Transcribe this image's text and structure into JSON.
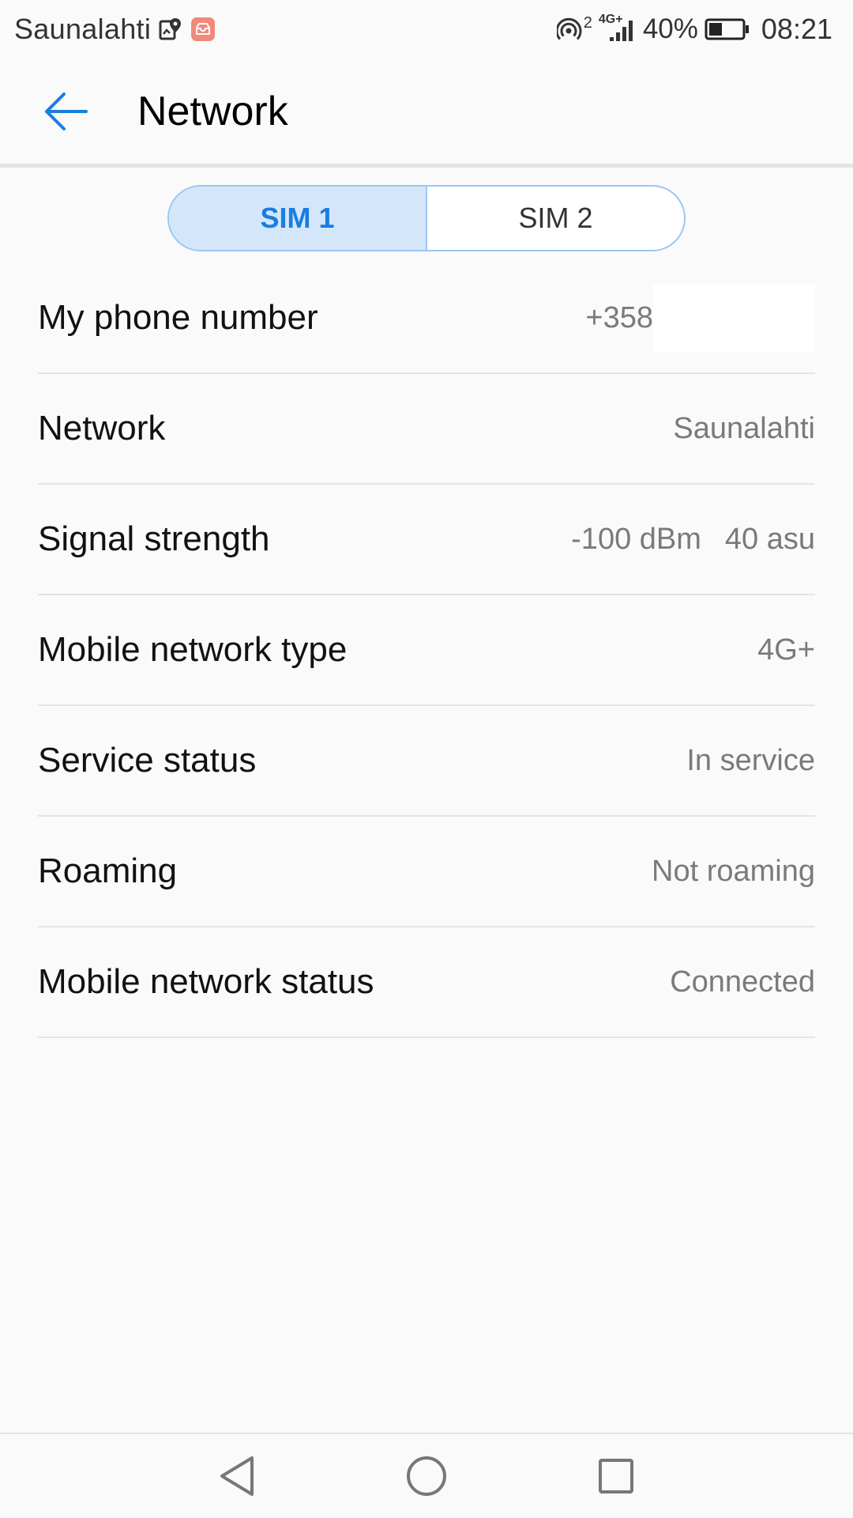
{
  "status_bar": {
    "carrier": "Saunalahti",
    "hotspot_superscript": "2",
    "network_type": "4G+",
    "battery_percent": "40%",
    "battery_level": 0.4,
    "time": "08:21",
    "icons": [
      "map-pin-icon",
      "mail-app-icon",
      "hotspot-icon",
      "signal-icon",
      "battery-icon"
    ]
  },
  "header": {
    "title": "Network"
  },
  "sim_tabs": {
    "selected": "SIM 1",
    "tabs": [
      {
        "label": "SIM 1"
      },
      {
        "label": "SIM 2"
      }
    ]
  },
  "info": {
    "phone_number": {
      "label": "My phone number",
      "value": "+358"
    },
    "network": {
      "label": "Network",
      "value": "Saunalahti"
    },
    "signal_strength": {
      "label": "Signal strength",
      "dbm": "-100 dBm",
      "asu": "40 asu"
    },
    "mobile_network_type": {
      "label": "Mobile network type",
      "value": "4G+"
    },
    "service_status": {
      "label": "Service status",
      "value": "In service"
    },
    "roaming": {
      "label": "Roaming",
      "value": "Not roaming"
    },
    "mobile_network_status": {
      "label": "Mobile network status",
      "value": "Connected"
    }
  },
  "colors": {
    "accent": "#1a7de0",
    "segment_active_bg": "#d4e7fa",
    "secondary_text": "#7a7a7a"
  }
}
